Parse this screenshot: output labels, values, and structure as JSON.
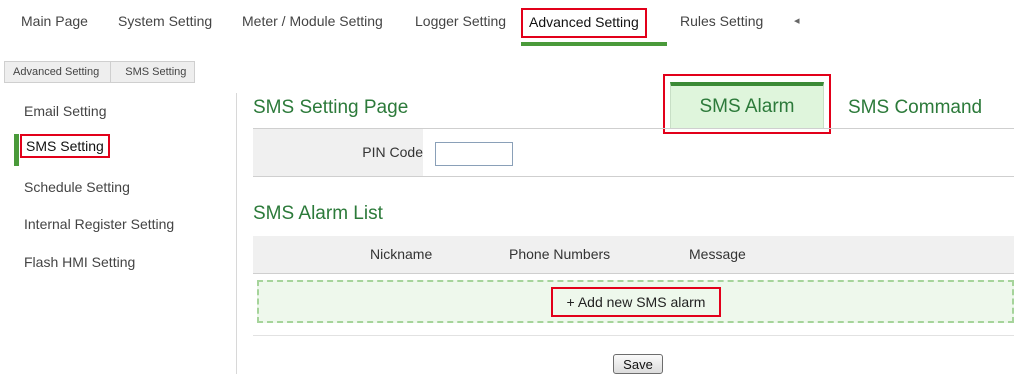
{
  "topnav": {
    "items": [
      "Main Page",
      "System Setting",
      "Meter / Module Setting",
      "Logger Setting",
      "Advanced Setting",
      "Rules Setting"
    ],
    "active": "Advanced Setting",
    "more_arrow": "◂"
  },
  "breadcrumb": [
    "Advanced Setting",
    "SMS Setting"
  ],
  "sidebar": {
    "items": [
      "Email Setting",
      "SMS Setting",
      "Schedule Setting",
      "Internal Register Setting",
      "Flash HMI Setting"
    ],
    "active": "SMS Setting"
  },
  "main": {
    "title": "SMS Setting Page",
    "tabs": [
      "SMS Alarm",
      "SMS Command"
    ],
    "active_tab": "SMS Alarm",
    "pin": {
      "label": "PIN Code",
      "value": ""
    },
    "list_title": "SMS Alarm List",
    "columns": [
      "Nickname",
      "Phone Numbers",
      "Message"
    ],
    "add_label": "+ Add new SMS alarm",
    "save_label": "Save"
  },
  "colors": {
    "accent_green": "#2c7a3a",
    "highlight_red": "#e2001a",
    "tab_bg": "#dff5dc"
  }
}
